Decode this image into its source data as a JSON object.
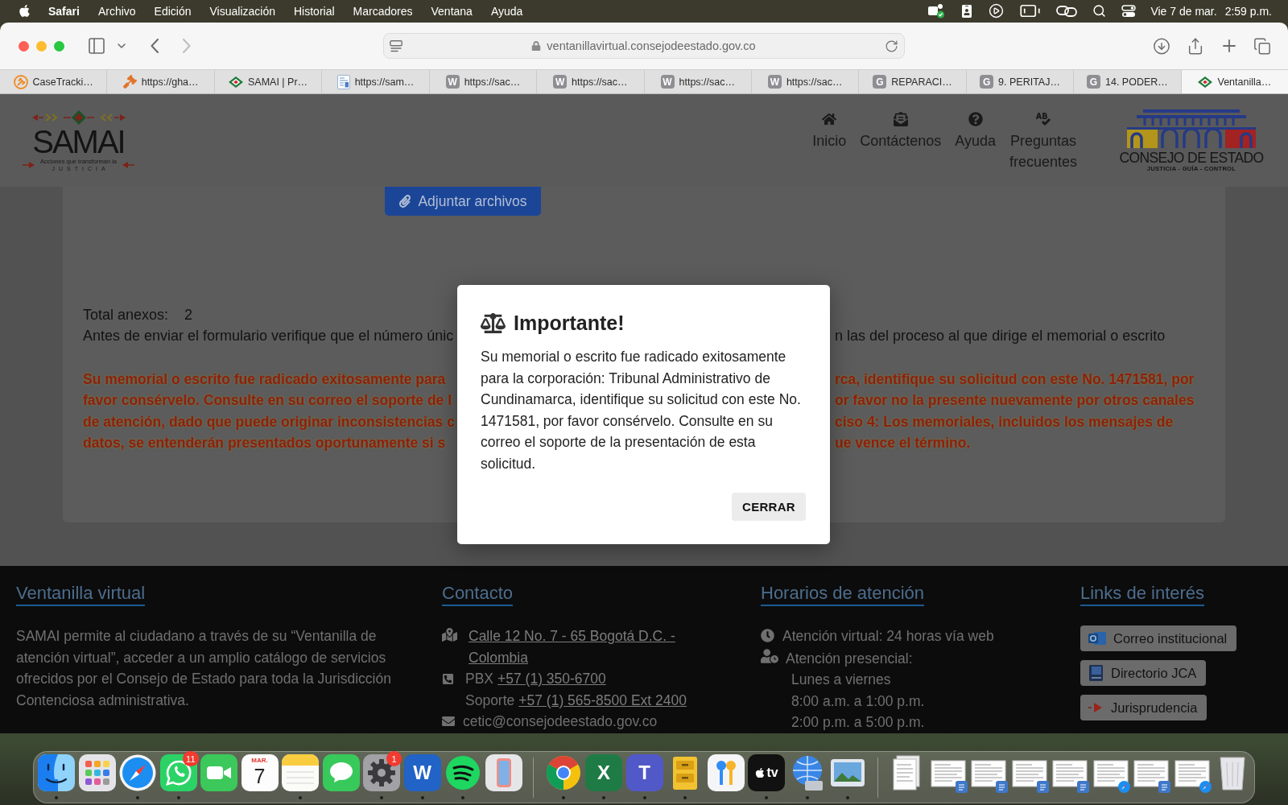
{
  "menu_bar": {
    "app": "Safari",
    "menus": [
      "Archivo",
      "Edición",
      "Visualización",
      "Historial",
      "Marcadores",
      "Ventana",
      "Ayuda"
    ],
    "date": "Vie 7 de mar.",
    "time": "2:59 p.m."
  },
  "browser": {
    "back_disabled": false,
    "forward_disabled": true,
    "address": "ventanillavirtual.consejodeestado.gov.co",
    "tabs": [
      {
        "label": "CaseTracki…",
        "kind": "gavel-circle",
        "selected": false
      },
      {
        "label": "https://gha…",
        "kind": "gavel",
        "selected": false
      },
      {
        "label": "SAMAI | Pr…",
        "kind": "diamond",
        "selected": false
      },
      {
        "label": "https://sam…",
        "kind": "document",
        "selected": false
      },
      {
        "label": "https://sac…",
        "kind": "letter",
        "letter": "W",
        "selected": false
      },
      {
        "label": "https://sac…",
        "kind": "letter",
        "letter": "W",
        "selected": false
      },
      {
        "label": "https://sac…",
        "kind": "letter",
        "letter": "W",
        "selected": false
      },
      {
        "label": "https://sac…",
        "kind": "letter",
        "letter": "W",
        "selected": false
      },
      {
        "label": "REPARACI…",
        "kind": "letter",
        "letter": "G",
        "selected": false
      },
      {
        "label": "9. PERITAJ…",
        "kind": "letter",
        "letter": "G",
        "selected": false
      },
      {
        "label": "14. PODER…",
        "kind": "letter",
        "letter": "G",
        "selected": false
      },
      {
        "label": "Ventanilla…",
        "kind": "diamond",
        "selected": true
      }
    ]
  },
  "site_header": {
    "logo": {
      "wordmark": "SAMAI",
      "tagline": "Acciones que transforman la",
      "subtitle": "JUSTICIA"
    },
    "nav": [
      {
        "label": "Inicio"
      },
      {
        "label": "Contáctenos"
      },
      {
        "label": "Ayuda"
      },
      {
        "label": "Preguntas frecuentes"
      }
    ],
    "seal": {
      "name": "CONSEJO DE ESTADO",
      "motto": "JUSTICIA - GUÍA - CONTROL"
    }
  },
  "form": {
    "attach_button": "Adjuntar archivos",
    "total_label": "Total anexos:",
    "total_value": "2",
    "notice": {
      "left": "Antes de enviar el formulario verifique que el número únic",
      "right": "n las del proceso al que dirige el memorial o escrito"
    },
    "alert_lines": [
      {
        "left": "Su memorial o escrito fue radicado exitosamente para",
        "right": "rca, identifique su solicitud con este No. 1471581, por"
      },
      {
        "left": "favor consérvelo. Consulte en su correo el soporte de l",
        "right": "or favor no la presente nuevamente por otros canales"
      },
      {
        "left": "de atención, dado que puede originar inconsistencias c",
        "right": "ciso 4: Los memoriales, incluidos los mensajes de"
      },
      {
        "left": "datos, se entenderán presentados oportunamente si s",
        "right": "ue vence el término."
      }
    ]
  },
  "modal": {
    "title": "Importante!",
    "body": "Su memorial o escrito fue radicado exitosamente para la corporación: Tribunal Administrativo de Cundinamarca, identifique su solicitud con este No. 1471581, por favor consérvelo. Consulte en su correo el soporte de la presentación de esta solicitud.",
    "button": "CERRAR"
  },
  "footer": {
    "columns": [
      {
        "kind": "about",
        "title": "Ventanilla virtual",
        "text": "SAMAI permite al ciudadano a través de su “Ventanilla de atención virtual”, acceder a un amplio catálogo de servicios ofrecidos por el Consejo de Estado para toda la Jurisdicción Contenciosa administrativa."
      },
      {
        "kind": "contact",
        "title": "Contacto",
        "lines": [
          {
            "kind": "address",
            "link": "Calle 12 No. 7 - 65 Bogotá D.C. - Colombia"
          },
          {
            "kind": "phone",
            "text": "PBX",
            "link": "+57 (1) 350-6700"
          },
          {
            "kind": "support",
            "text": "Soporte",
            "link": "+57 (1) 565-8500 Ext 2400"
          },
          {
            "kind": "email",
            "text": "cetic@consejodeestado.gov.co"
          }
        ]
      },
      {
        "kind": "hours",
        "title": "Horarios de atención",
        "lines": [
          {
            "kind": "online",
            "text": "Atención virtual: 24 horas vía web"
          },
          {
            "kind": "in-person",
            "text": "Atención presencial:"
          },
          {
            "kind": "detail",
            "text": "Lunes a viernes"
          },
          {
            "kind": "detail",
            "text": "8:00 a.m. a 1:00 p.m."
          },
          {
            "kind": "detail",
            "text": "2:00 p.m. a 5:00 p.m."
          }
        ]
      },
      {
        "kind": "links",
        "title": "Links de interés",
        "links": [
          {
            "label": "Correo institucional"
          },
          {
            "label": "Directorio JCA"
          },
          {
            "label": "Jurisprudencia"
          }
        ]
      }
    ]
  },
  "dock": {
    "sections": [
      {
        "items": [
          {
            "kind": "face",
            "running": true
          },
          {
            "kind": "grid",
            "running": false
          },
          {
            "kind": "compass",
            "running": true
          },
          {
            "kind": "chat-phone",
            "running": true,
            "badge": "11"
          },
          {
            "kind": "video",
            "running": false
          },
          {
            "kind": "calendar",
            "running": false,
            "month": "MAR.",
            "day": "7"
          },
          {
            "kind": "notepad",
            "running": true
          },
          {
            "kind": "bubble",
            "running": false
          },
          {
            "kind": "gear",
            "running": true,
            "badge": "1"
          },
          {
            "kind": "letter",
            "letter": "W",
            "color": "#2163c6",
            "running": true
          },
          {
            "kind": "waves",
            "running": true
          },
          {
            "kind": "phone",
            "running": false
          }
        ]
      },
      {
        "items": [
          {
            "kind": "wheel",
            "running": true
          },
          {
            "kind": "letter",
            "letter": "X",
            "color": "#1e7b45",
            "running": true
          },
          {
            "kind": "letter",
            "letter": "T",
            "color": "#5159c8",
            "running": true
          },
          {
            "kind": "cabinet",
            "running": true
          },
          {
            "kind": "keys",
            "running": false
          },
          {
            "kind": "tv",
            "label": "tv",
            "running": true
          },
          {
            "kind": "globe",
            "running": true
          },
          {
            "kind": "photos",
            "running": true
          }
        ]
      },
      {
        "items": [
          {
            "kind": "stack"
          },
          {
            "kind": "doc-window"
          },
          {
            "kind": "doc-window"
          },
          {
            "kind": "doc-window"
          },
          {
            "kind": "doc-window"
          },
          {
            "kind": "web-window"
          },
          {
            "kind": "doc-window"
          },
          {
            "kind": "web-window"
          },
          {
            "kind": "trash"
          }
        ]
      }
    ]
  }
}
